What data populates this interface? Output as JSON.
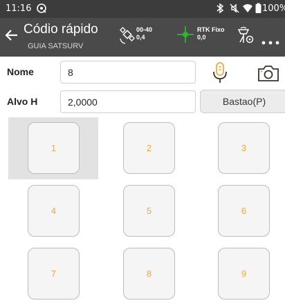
{
  "status_bar": {
    "time": "11:16",
    "battery": "100%",
    "icons": [
      "location-icon",
      "bluetooth-icon",
      "mute-icon",
      "wifi-icon",
      "battery-icon"
    ]
  },
  "app_bar": {
    "title": "Códio rápido",
    "subtitle": "GUIA SATSURV",
    "satellites_top": "00-40",
    "satellites_bottom": "0,4",
    "rtk_status": "RTK Fixo",
    "rtk_value": "0,0"
  },
  "form": {
    "name_label": "Nome",
    "name_value": "8",
    "target_label": "Alvo H",
    "target_value": "2,0000",
    "pole_button": "Bastao(P)"
  },
  "keypad": {
    "keys": [
      {
        "label": "1",
        "selected": true
      },
      {
        "label": "2",
        "selected": false
      },
      {
        "label": "3",
        "selected": false
      },
      {
        "label": "4",
        "selected": false
      },
      {
        "label": "5",
        "selected": false
      },
      {
        "label": "6",
        "selected": false
      },
      {
        "label": "7",
        "selected": false
      },
      {
        "label": "8",
        "selected": false
      },
      {
        "label": "9",
        "selected": false
      }
    ]
  },
  "colors": {
    "status_bar": "#3c3c3c",
    "app_bar": "#4a4a4a",
    "key_text": "#f2a93b",
    "gps_accent": "#2db52d"
  }
}
